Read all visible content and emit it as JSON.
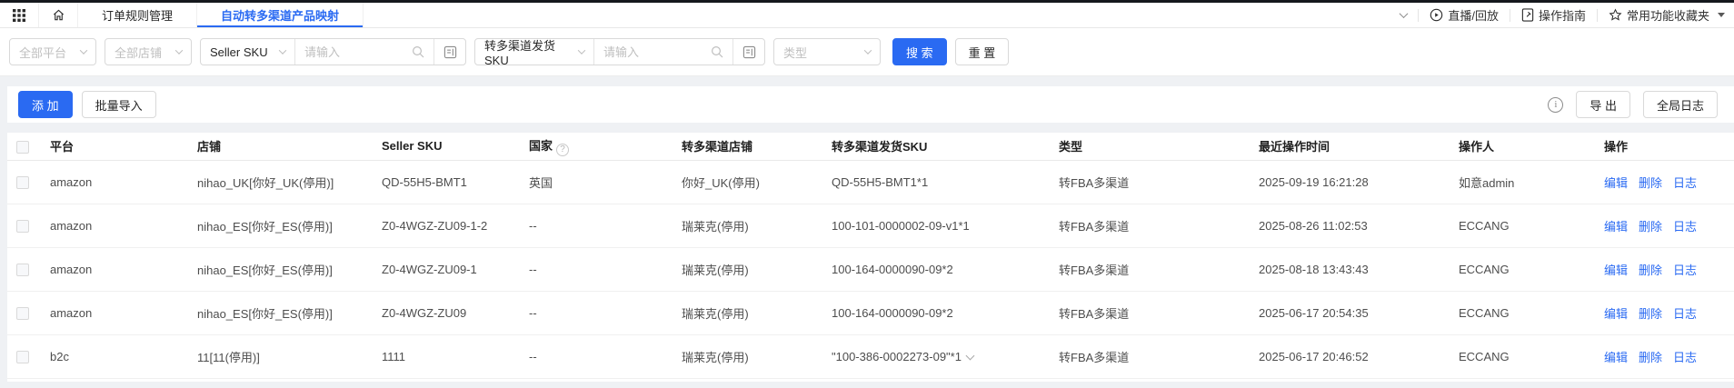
{
  "topnav": {
    "tabs": [
      {
        "label": "订单规则管理"
      },
      {
        "label": "自动转多渠道产品映射"
      }
    ],
    "live_label": "直播/回放",
    "guide_label": "操作指南",
    "favorites_label": "常用功能收藏夹"
  },
  "filters": {
    "platform_placeholder": "全部平台",
    "shop_placeholder": "全部店铺",
    "seller_sku_label": "Seller SKU",
    "seller_sku_placeholder": "请输入",
    "channel_sku_label": "转多渠道发货SKU",
    "channel_sku_placeholder": "请输入",
    "type_placeholder": "类型",
    "search_label": "搜 索",
    "reset_label": "重 置"
  },
  "toolbar": {
    "add_label": "添 加",
    "batch_import_label": "批量导入",
    "export_label": "导 出",
    "global_log_label": "全局日志",
    "info_glyph": "i"
  },
  "table": {
    "headers": [
      "平台",
      "店铺",
      "Seller SKU",
      "国家",
      "转多渠道店铺",
      "转多渠道发货SKU",
      "类型",
      "最近操作时间",
      "操作人",
      "操作"
    ],
    "country_help_glyph": "?",
    "actions": [
      "编辑",
      "删除",
      "日志"
    ],
    "rows": [
      {
        "platform": "amazon",
        "shop": "nihao_UK[你好_UK(停用)]",
        "seller_sku": "QD-55H5-BMT1",
        "country": "英国",
        "channel_shop": "你好_UK(停用)",
        "channel_sku": "QD-55H5-BMT1*1",
        "expandable": false,
        "type": "转FBA多渠道",
        "time": "2025-09-19 16:21:28",
        "operator": "如意admin"
      },
      {
        "platform": "amazon",
        "shop": "nihao_ES[你好_ES(停用)]",
        "seller_sku": "Z0-4WGZ-ZU09-1-2",
        "country": "--",
        "channel_shop": "瑞莱克(停用)",
        "channel_sku": "100-101-0000002-09-v1*1",
        "expandable": false,
        "type": "转FBA多渠道",
        "time": "2025-08-26 11:02:53",
        "operator": "ECCANG"
      },
      {
        "platform": "amazon",
        "shop": "nihao_ES[你好_ES(停用)]",
        "seller_sku": "Z0-4WGZ-ZU09-1",
        "country": "--",
        "channel_shop": "瑞莱克(停用)",
        "channel_sku": "100-164-0000090-09*2",
        "expandable": false,
        "type": "转FBA多渠道",
        "time": "2025-08-18 13:43:43",
        "operator": "ECCANG"
      },
      {
        "platform": "amazon",
        "shop": "nihao_ES[你好_ES(停用)]",
        "seller_sku": "Z0-4WGZ-ZU09",
        "country": "--",
        "channel_shop": "瑞莱克(停用)",
        "channel_sku": "100-164-0000090-09*2",
        "expandable": false,
        "type": "转FBA多渠道",
        "time": "2025-06-17 20:54:35",
        "operator": "ECCANG"
      },
      {
        "platform": "b2c",
        "shop": "11[11(停用)]",
        "seller_sku": "1111",
        "country": "--",
        "channel_shop": "瑞莱克(停用)",
        "channel_sku": "\"100-386-0002273-09\"*1",
        "expandable": true,
        "type": "转FBA多渠道",
        "time": "2025-06-17 20:46:52",
        "operator": "ECCANG"
      }
    ]
  },
  "icons": {
    "apps": "grid-3x3",
    "home": "house-outline",
    "live": "play-circle",
    "guide": "document-page",
    "favorites": "star-outline",
    "tabs_collapse": "chevron-down",
    "search": "magnifier",
    "batch_input": "form-lines",
    "info": "info-circle",
    "country_help": "question-circle",
    "sku_expand": "chevron-down"
  },
  "colors": {
    "accent": "#2a6af2",
    "page_background": "#eff1f4",
    "border": "#e8e8e8",
    "placeholder": "#bfbfbf",
    "top_edge": "#15181d"
  }
}
